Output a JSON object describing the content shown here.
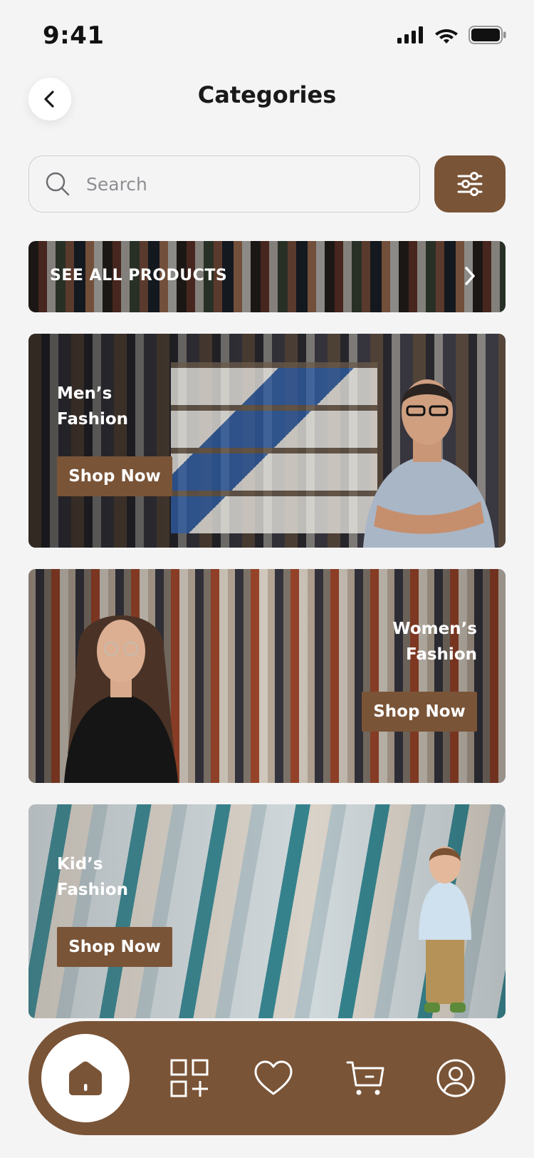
{
  "status_bar": {
    "time": "9:41"
  },
  "header": {
    "title": "Categories"
  },
  "search": {
    "placeholder": "Search"
  },
  "see_all": {
    "label": "SEE ALL PRODUCTS"
  },
  "categories": [
    {
      "title_line1": "Men’s",
      "title_line2": "Fashion",
      "button": "Shop Now"
    },
    {
      "title_line1": "Women’s",
      "title_line2": "Fashion",
      "button": "Shop Now"
    },
    {
      "title_line1": "Kid’s",
      "title_line2": "Fashion",
      "button": "Shop Now"
    }
  ],
  "bottom_nav": {
    "items": [
      "home-icon",
      "categories-icon",
      "heart-icon",
      "cart-icon",
      "profile-icon"
    ],
    "active": "home-icon"
  },
  "colors": {
    "accent": "#7a5437",
    "background": "#f4f4f5"
  }
}
